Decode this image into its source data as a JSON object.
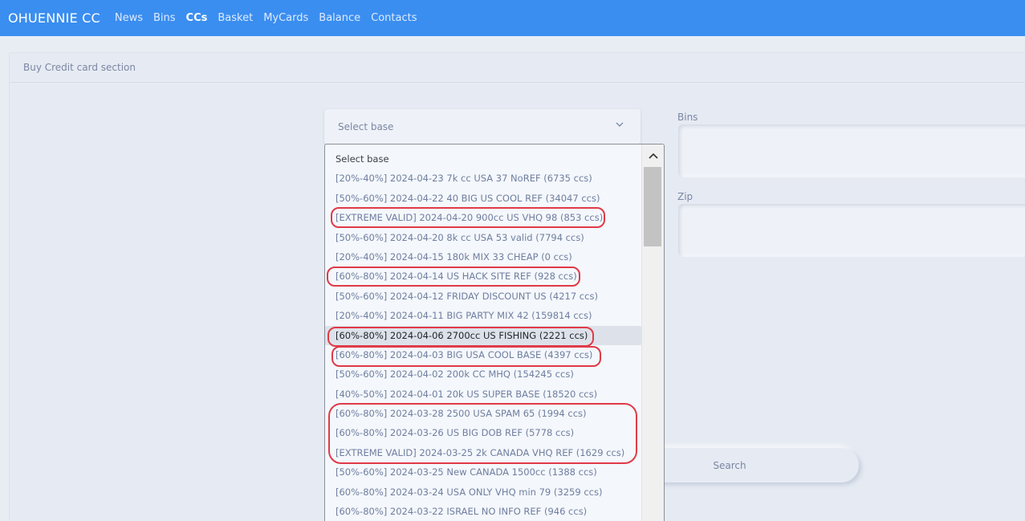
{
  "nav": {
    "brand": "OHUENNIE CC",
    "links": [
      "News",
      "Bins",
      "CCs",
      "Basket",
      "MyCards",
      "Balance",
      "Contacts"
    ]
  },
  "section": {
    "title": "Buy Credit card section"
  },
  "select": {
    "placeholder": "Select base",
    "icon": "chevron-down-icon"
  },
  "fields": {
    "bins_label": "Bins",
    "zip_label": "Zip"
  },
  "search": {
    "label": "Search"
  },
  "dropdown": {
    "hovered_index": 9,
    "options": [
      "Select base",
      "[20%-40%] 2024-04-23 7k cc USA 37 NoREF (6735 ccs)",
      "[50%-60%] 2024-04-22 40 BIG US COOL REF (34047 ccs)",
      "[EXTREME VALID] 2024-04-20 900cc US VHQ 98 (853 ccs)",
      "[50%-60%] 2024-04-20 8k cc USA 53 valid (7794 ccs)",
      "[20%-40%] 2024-04-15 180k MIX 33 CHEAP (0 ccs)",
      "[60%-80%] 2024-04-14 US HACK SITE REF (928 ccs)",
      "[50%-60%] 2024-04-12 FRIDAY DISCOUNT US (4217 ccs)",
      "[20%-40%] 2024-04-11 BIG PARTY MIX 42 (159814 ccs)",
      "[60%-80%] 2024-04-06 2700cc US FISHING (2221 ccs)",
      "[60%-80%] 2024-04-03 BIG USA COOL BASE (4397 ccs)",
      "[50%-60%] 2024-04-02 200k CC MHQ (154245 ccs)",
      "[40%-50%] 2024-04-01 20k US SUPER BASE (18520 ccs)",
      "[60%-80%] 2024-03-28 2500 USA SPAM 65 (1994 ccs)",
      "[60%-80%] 2024-03-26 US BIG DOB REF (5778 ccs)",
      "[EXTREME VALID] 2024-03-25 2k CANADA VHQ REF (1629 ccs)",
      "[50%-60%] 2024-03-25 New CANADA 1500cc (1388 ccs)",
      "[60%-80%] 2024-03-24 USA ONLY VHQ min 79 (3259 ccs)",
      "[60%-80%] 2024-03-22 ISRAEL NO INFO REF (946 ccs)"
    ]
  },
  "colors": {
    "navbar": "#3a8ef0",
    "annotation": "#e03a48"
  }
}
